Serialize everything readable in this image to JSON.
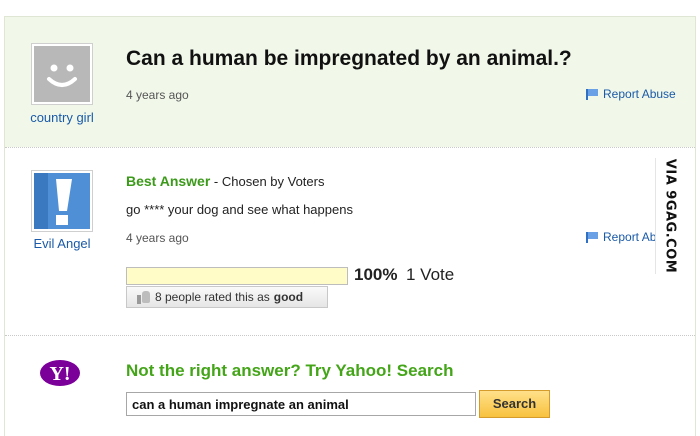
{
  "question": {
    "title": "Can a human be impregnated by an animal.?",
    "time": "4 years ago",
    "user": "country girl",
    "report_label": "Report Abuse"
  },
  "answer": {
    "best_label": "Best Answer",
    "chosen_by": "- Chosen by Voters",
    "text": "go **** your dog and see what happens",
    "time": "4 years ago",
    "user": "Evil Angel",
    "report_label": "Report Abuse",
    "vote_percent": "100%",
    "vote_percent_value": 100,
    "vote_count": "1 Vote",
    "rated_prefix": "8 people rated this as",
    "rated_value": "good"
  },
  "yahoo": {
    "logo_text": "Y!",
    "not_right": "Not the right answer? Try Yahoo! Search",
    "search_value": "can a human impregnate an animal",
    "search_button": "Search"
  },
  "watermark": "VIA 9GAG.COM",
  "colors": {
    "question_bg": "#f1f8ea",
    "link_blue": "#1a5aa8",
    "best_green": "#3c9a1a",
    "yahoo_purple": "#7b0099",
    "search_button": "#f8c23e"
  }
}
